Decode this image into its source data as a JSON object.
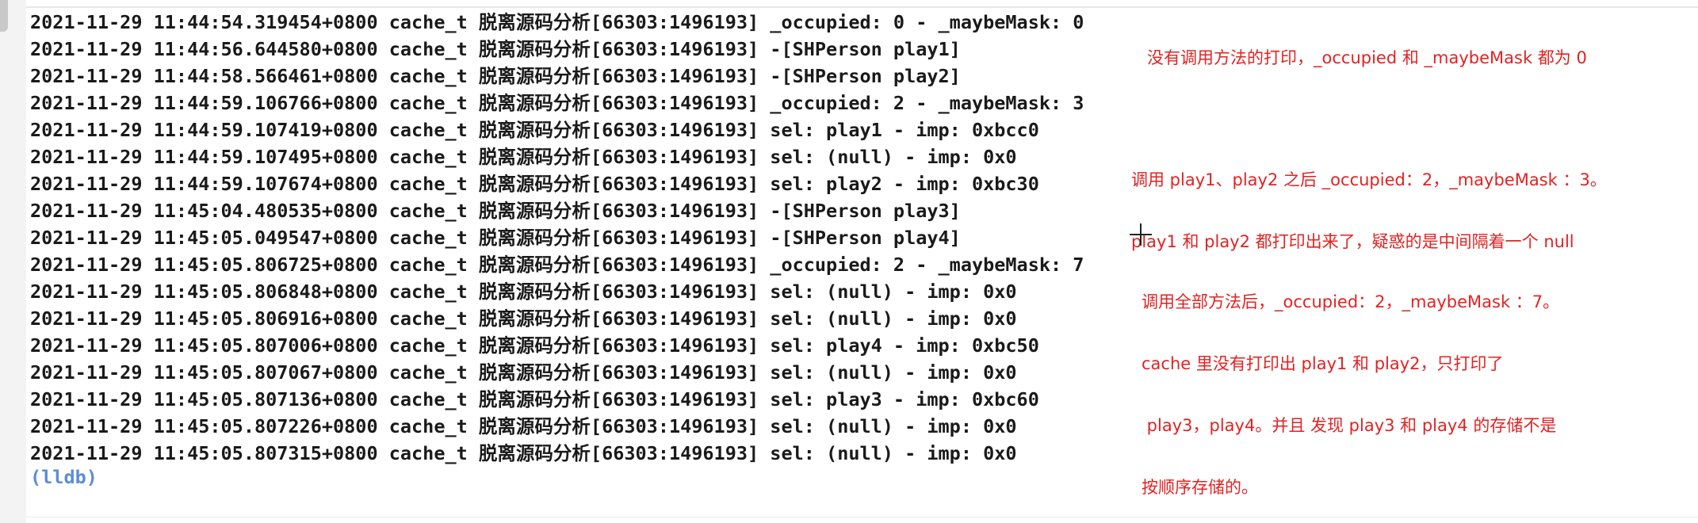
{
  "console": {
    "lines": [
      "2021-11-29 11:44:54.319454+0800 cache_t 脱离源码分析[66303:1496193] _occupied: 0 - _maybeMask: 0",
      "2021-11-29 11:44:56.644580+0800 cache_t 脱离源码分析[66303:1496193] -[SHPerson play1]",
      "2021-11-29 11:44:58.566461+0800 cache_t 脱离源码分析[66303:1496193] -[SHPerson play2]",
      "2021-11-29 11:44:59.106766+0800 cache_t 脱离源码分析[66303:1496193] _occupied: 2 - _maybeMask: 3",
      "2021-11-29 11:44:59.107419+0800 cache_t 脱离源码分析[66303:1496193] sel: play1 - imp: 0xbcc0",
      "2021-11-29 11:44:59.107495+0800 cache_t 脱离源码分析[66303:1496193] sel: (null) - imp: 0x0",
      "2021-11-29 11:44:59.107674+0800 cache_t 脱离源码分析[66303:1496193] sel: play2 - imp: 0xbc30",
      "2021-11-29 11:45:04.480535+0800 cache_t 脱离源码分析[66303:1496193] -[SHPerson play3]",
      "2021-11-29 11:45:05.049547+0800 cache_t 脱离源码分析[66303:1496193] -[SHPerson play4]",
      "2021-11-29 11:45:05.806725+0800 cache_t 脱离源码分析[66303:1496193] _occupied: 2 - _maybeMask: 7",
      "2021-11-29 11:45:05.806848+0800 cache_t 脱离源码分析[66303:1496193] sel: (null) - imp: 0x0",
      "2021-11-29 11:45:05.806916+0800 cache_t 脱离源码分析[66303:1496193] sel: (null) - imp: 0x0",
      "2021-11-29 11:45:05.807006+0800 cache_t 脱离源码分析[66303:1496193] sel: play4 - imp: 0xbc50",
      "2021-11-29 11:45:05.807067+0800 cache_t 脱离源码分析[66303:1496193] sel: (null) - imp: 0x0",
      "2021-11-29 11:45:05.807136+0800 cache_t 脱离源码分析[66303:1496193] sel: play3 - imp: 0xbc60",
      "2021-11-29 11:45:05.807226+0800 cache_t 脱离源码分析[66303:1496193] sel: (null) - imp: 0x0",
      "2021-11-29 11:45:05.807315+0800 cache_t 脱离源码分析[66303:1496193] sel: (null) - imp: 0x0"
    ],
    "prompt": "(lldb)"
  },
  "annotations": [
    {
      "lines": [
        "没有调用方法的打印，_occupied 和 _maybeMask 都为 0"
      ]
    },
    {
      "lines": [
        "调用 play1、play2 之后 _occupied：2，_maybeMask ：3。",
        "play1 和 play2 都打印出来了，疑惑的是中间隔着一个 null"
      ]
    },
    {
      "lines": [
        "调用全部方法后，_occupied：2，_maybeMask ：7。",
        "cache 里没有打印出 play1 和 play2，只打印了",
        " play3，play4。并且 发现 play3 和 play4 的存储不是",
        "按顺序存储的。"
      ]
    }
  ],
  "colors": {
    "console_text": "#1a1a1a",
    "prompt": "#5b8dd6",
    "annotation": "#e32222",
    "background": "#ffffff"
  },
  "icons": {
    "cursor": "crosshair-cursor-icon"
  }
}
